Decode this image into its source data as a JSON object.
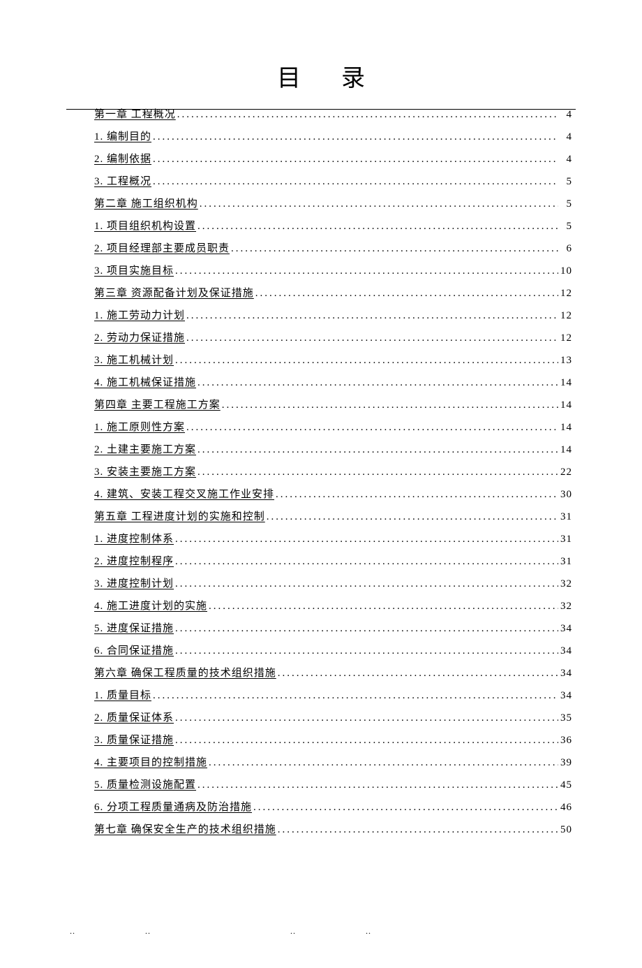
{
  "title": "目录",
  "toc": [
    {
      "label": "第一章  工程概况",
      "page": "4"
    },
    {
      "label": "1. 编制目的",
      "page": "4"
    },
    {
      "label": "2. 编制依据",
      "page": "4"
    },
    {
      "label": "3. 工程概况",
      "page": "5"
    },
    {
      "label": "第二章  施工组织机构",
      "page": "5"
    },
    {
      "label": "1. 项目组织机构设置",
      "page": "5"
    },
    {
      "label": "2. 项目经理部主要成员职责",
      "page": "6"
    },
    {
      "label": "3. 项目实施目标",
      "page": "10"
    },
    {
      "label": "第三章  资源配备计划及保证措施",
      "page": "12"
    },
    {
      "label": "1. 施工劳动力计划",
      "page": "12"
    },
    {
      "label": "2. 劳动力保证措施",
      "page": "12"
    },
    {
      "label": "3. 施工机械计划",
      "page": "13"
    },
    {
      "label": "4. 施工机械保证措施",
      "page": "14"
    },
    {
      "label": "第四章  主要工程施工方案",
      "page": "14"
    },
    {
      "label": "1. 施工原则性方案",
      "page": "14"
    },
    {
      "label": "2. 土建主要施工方案",
      "page": "14"
    },
    {
      "label": "3. 安装主要施工方案",
      "page": "22"
    },
    {
      "label": "4. 建筑、安装工程交叉施工作业安排",
      "page": "30"
    },
    {
      "label": "第五章  工程进度计划的实施和控制",
      "page": "31"
    },
    {
      "label": "1. 进度控制体系",
      "page": "31"
    },
    {
      "label": "2. 进度控制程序",
      "page": "31"
    },
    {
      "label": "3. 进度控制计划",
      "page": "32"
    },
    {
      "label": "4. 施工进度计划的实施",
      "page": "32"
    },
    {
      "label": "5. 进度保证措施",
      "page": "34"
    },
    {
      "label": "6. 合同保证措施",
      "page": "34"
    },
    {
      "label": "第六章  确保工程质量的技术组织措施",
      "page": "34"
    },
    {
      "label": "1. 质量目标",
      "page": "34"
    },
    {
      "label": "2. 质量保证体系",
      "page": "35"
    },
    {
      "label": "3. 质量保证措施",
      "page": "36"
    },
    {
      "label": "4. 主要项目的控制措施",
      "page": "39"
    },
    {
      "label": "5. 质量检测设施配置",
      "page": "45"
    },
    {
      "label": "6. 分项工程质量通病及防治措施",
      "page": "46"
    },
    {
      "label": "第七章  确保安全生产的技术组织措施",
      "page": "50"
    }
  ]
}
